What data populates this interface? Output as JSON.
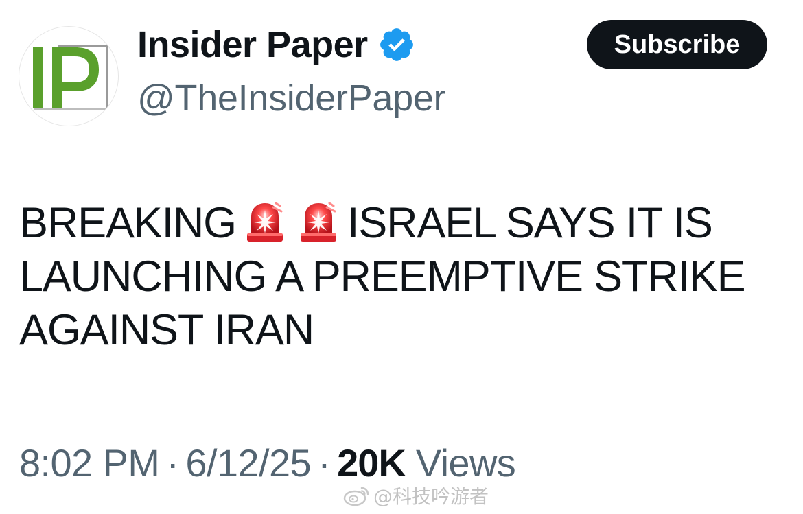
{
  "header": {
    "avatar_label": "IP",
    "display_name": "Insider Paper",
    "handle": "@TheInsiderPaper",
    "verified": true,
    "subscribe_label": "Subscribe"
  },
  "tweet": {
    "line1_before": "BREAKING",
    "line1_after": "ISRAEL SAYS IT IS",
    "line2": "LAUNCHING A PREEMPTIVE STRIKE",
    "line3": "AGAINST IRAN",
    "emoji": [
      "police-car-light",
      "police-car-light"
    ]
  },
  "meta": {
    "time": "8:02 PM",
    "separator": "·",
    "date": "6/12/25",
    "views_count": "20K",
    "views_label": "Views"
  },
  "watermark": {
    "text": "@科技吟游者"
  },
  "colors": {
    "text_primary": "#0f1419",
    "text_secondary": "#536471",
    "verified_blue": "#1d9bf0",
    "logo_green": "#5aa02c",
    "button_bg": "#0f1419",
    "siren_red": "#e8252b"
  }
}
